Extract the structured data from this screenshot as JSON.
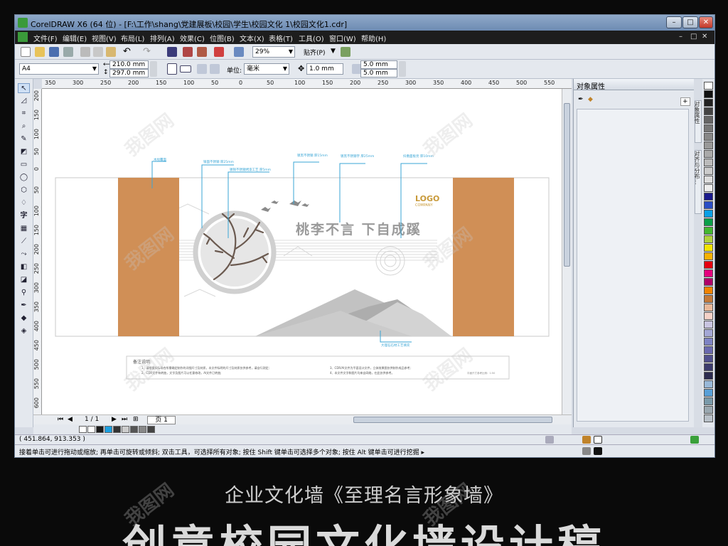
{
  "window": {
    "title": "CorelDRAW X6 (64 位) - [F:\\工作\\shang\\党建展板\\校园\\学生\\校园文化 1\\校园文化1.cdr]"
  },
  "menu": {
    "items": [
      "文件(F)",
      "编辑(E)",
      "视图(V)",
      "布局(L)",
      "排列(A)",
      "效果(C)",
      "位图(B)",
      "文本(X)",
      "表格(T)",
      "工具(O)",
      "窗口(W)",
      "帮助(H)"
    ]
  },
  "toolbar": {
    "zoom": "29%",
    "snap": "贴齐(P)"
  },
  "property_bar": {
    "page_size": "A4",
    "width": "210.0 mm",
    "height": "297.0 mm",
    "units_label": "单位:",
    "units": "毫米",
    "nudge": "1.0 mm",
    "dup_x": "5.0 mm",
    "dup_y": "5.0 mm"
  },
  "ruler": {
    "h_ticks": [
      "350",
      "300",
      "250",
      "200",
      "150",
      "100",
      "50",
      "0",
      "50",
      "100",
      "150",
      "200",
      "250",
      "300",
      "350",
      "400",
      "450",
      "500",
      "550"
    ],
    "v_ticks": [
      "200",
      "150",
      "100",
      "50",
      "0",
      "50",
      "100",
      "150",
      "200",
      "250",
      "300",
      "350",
      "400",
      "450",
      "500",
      "550",
      "600"
    ]
  },
  "design": {
    "slogan": "桃李不言 下自成蹊",
    "logo": "LOGO",
    "logo_sub": "COMPANY",
    "colors": {
      "pillar": "#d08f56",
      "mountain": "#c2c2c2",
      "line": "#3aa6d6",
      "logo": "#c89a3a"
    },
    "callouts": [
      "木纹覆面",
      "银面不锈钢 厚25mm",
      "镀铜不锈钢烤漆工艺 厚5mm",
      "镀黑不锈钢 厚15mm",
      "镀黑不锈钢字 厚25mm",
      "抖擞面板亮 厚10mm",
      "大理石石材工艺填充"
    ],
    "notes": {
      "title": "备注说明:",
      "lines": [
        "1、请根据实际场合所需确定制作的详细尺寸及材质，本文件标明的尺寸及材质仅供参考，请自行测定;",
        "2、CDR文件有转曲，文字及图片可以任意修改，AI文件已转曲;",
        "3、CDR/AI文件为平面设计文件，立体效果图仅供制作成品参考;",
        "4、本文件文字和图片均来自网络，在此仅供参考。"
      ],
      "scale": "平面尺寸参考比例：1:50"
    }
  },
  "pager": {
    "position": "1 / 1",
    "tab": "页 1"
  },
  "docker": {
    "title": "对象属性",
    "tab1": "对象属性",
    "tab2": "对齐与分布..."
  },
  "status": {
    "coords": "( 451.864, 913.353 )",
    "hint": "接着单击可进行拖动或缩放; 再单击可旋转或倾斜; 双击工具，可选择所有对象; 按住 Shift 键单击可选择多个对象; 按住 Alt 键单击可进行挖掘 ▸"
  },
  "caption": "企业文化墙《至理名言形象墙》",
  "big_caption": "创意校园文化墙设计稿",
  "watermark": "我图网",
  "palette_colors": [
    "#ffffff",
    "#111111",
    "#222222",
    "#444444",
    "#666666",
    "#777777",
    "#888888",
    "#999999",
    "#aaaaaa",
    "#bbbbbb",
    "#cccccc",
    "#dddddd",
    "#eeeeee",
    "#1a1a8c",
    "#2b4fc6",
    "#0aa0e6",
    "#0aa04a",
    "#43b830",
    "#b0d23c",
    "#f2e400",
    "#f7b100",
    "#e60012",
    "#e4007f",
    "#b0006a",
    "#f08300",
    "#c47a3a",
    "#e8b89a",
    "#f5d2c8",
    "#c8c4e0",
    "#a4a8d6",
    "#7d83c4",
    "#6a6ab0",
    "#50508e",
    "#3c3c6e",
    "#2c2c50",
    "#98b8d8",
    "#58a0d8",
    "#7a9aaa",
    "#9aa8b0",
    "#b8c0c8"
  ]
}
